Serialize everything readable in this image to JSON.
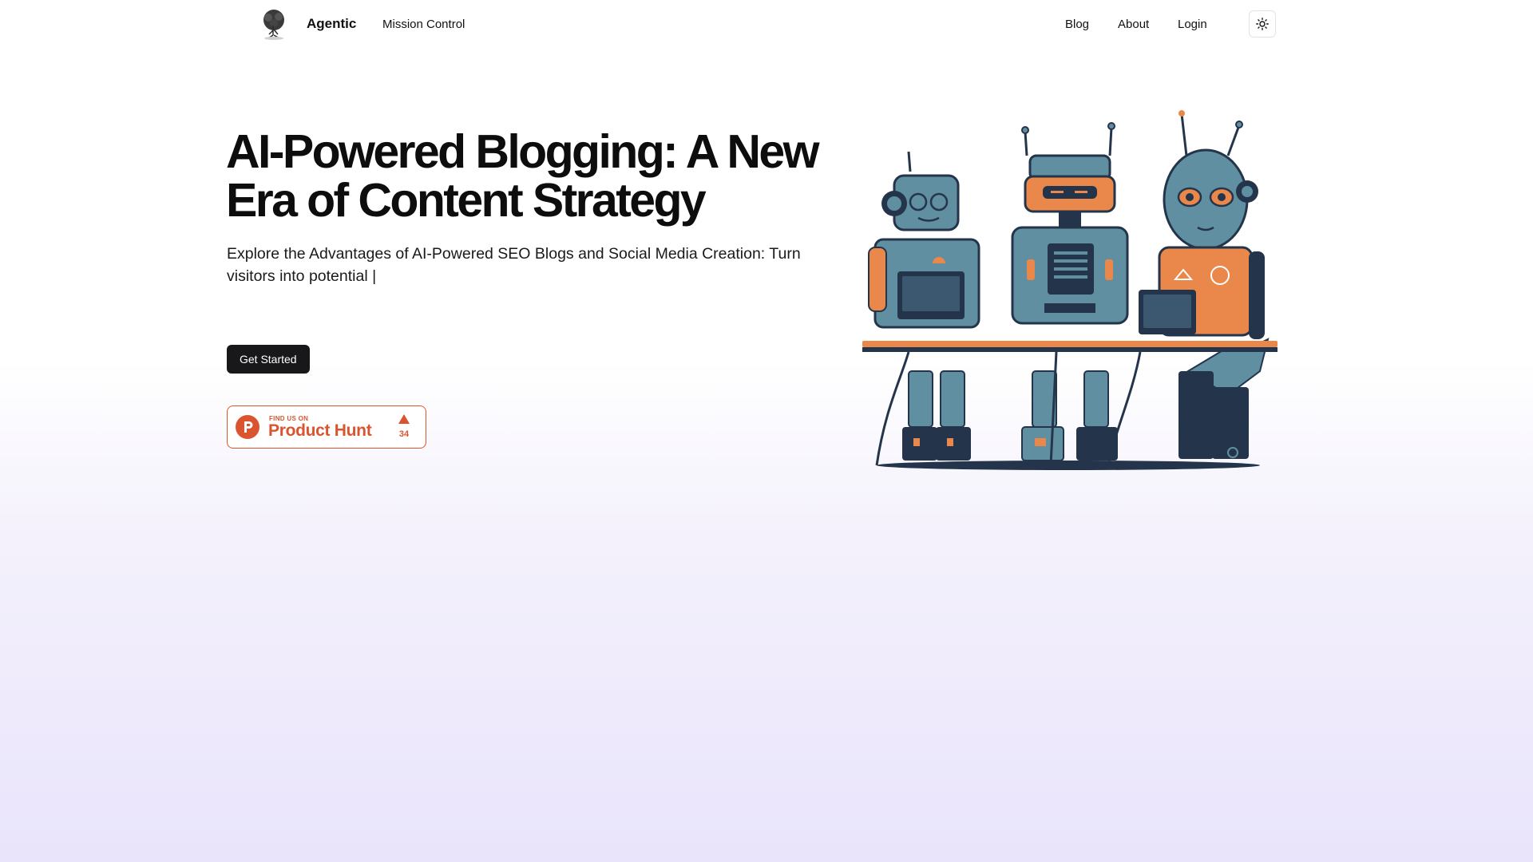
{
  "header": {
    "brand": "Agentic",
    "logo_icon": "tree-brain-logo-icon",
    "nav_left": [
      "Mission Control"
    ],
    "nav_right": [
      "Blog",
      "About",
      "Login"
    ],
    "theme_toggle_icon": "sun-icon"
  },
  "hero": {
    "title": "AI-Powered Blogging: A New Era of Content Strategy",
    "subtitle": "Explore the Advantages of AI-Powered SEO Blogs and Social Media Creation: Turn visitors into potential |",
    "cta_label": "Get Started",
    "illustration": "three-robots-at-desk-illustration"
  },
  "product_hunt": {
    "kicker": "FIND US ON",
    "name": "Product Hunt",
    "votes": "34",
    "icon": "product-hunt-logo-icon",
    "accent": "#da552f"
  },
  "colors": {
    "text": "#111111",
    "button_bg": "#18181b",
    "gradient_bottom": "#e9e4fb",
    "robot_teal": "#5f8fa0",
    "robot_navy": "#24354b",
    "robot_orange": "#e9884a"
  }
}
